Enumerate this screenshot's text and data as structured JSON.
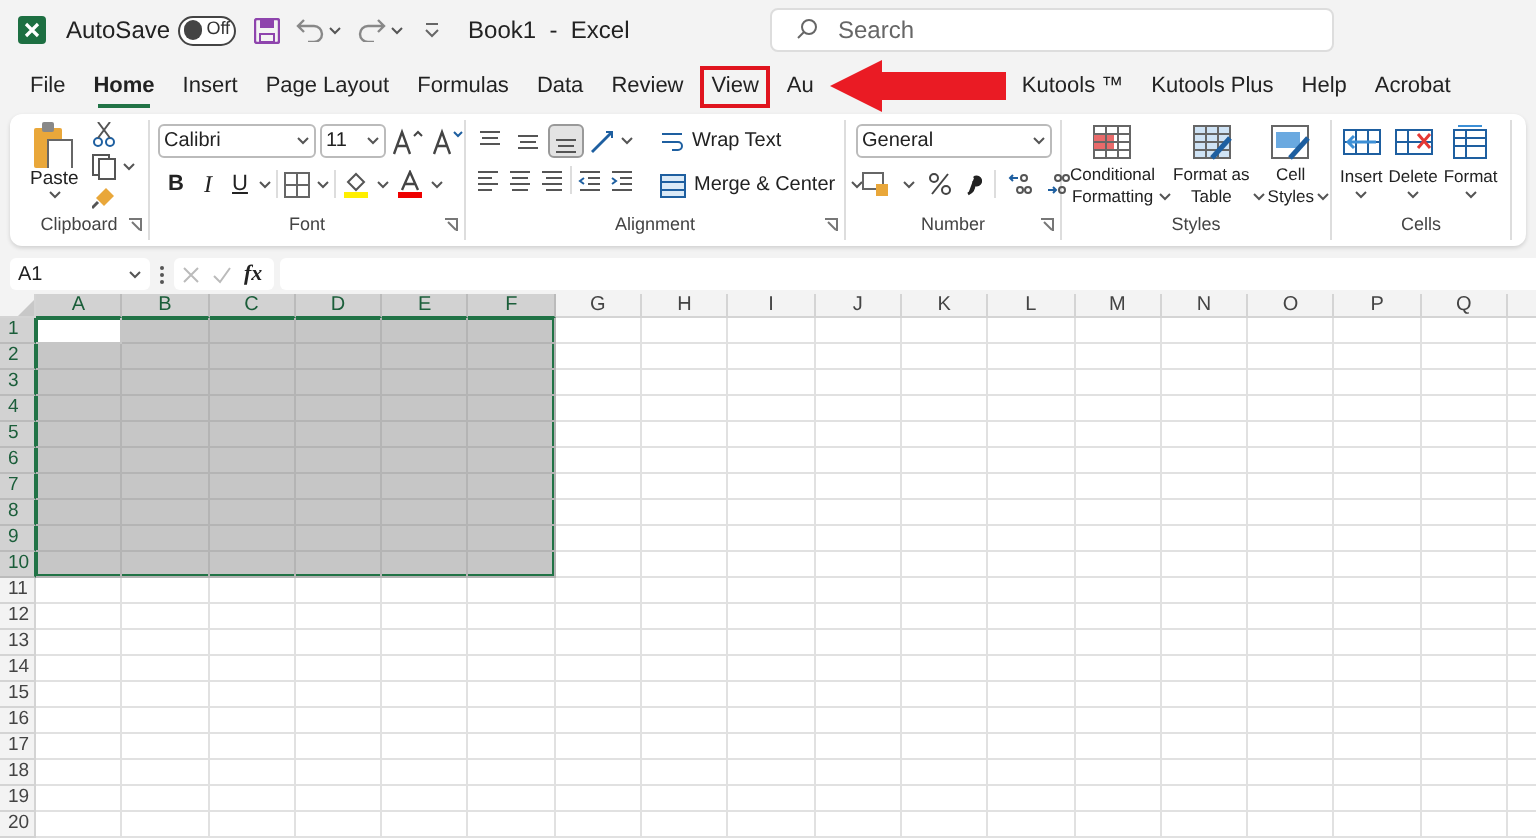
{
  "title_bar": {
    "autosave_label": "AutoSave",
    "autosave": {
      "on": false,
      "label": "Off"
    },
    "document_title": "Book1  -  Excel",
    "search": {
      "placeholder": "Search"
    }
  },
  "tabs": [
    {
      "label": "File",
      "selected": false,
      "highlighted": false
    },
    {
      "label": "Home",
      "selected": true,
      "highlighted": false
    },
    {
      "label": "Insert",
      "selected": false,
      "highlighted": false
    },
    {
      "label": "Page Layout",
      "selected": false,
      "highlighted": false
    },
    {
      "label": "Formulas",
      "selected": false,
      "highlighted": false
    },
    {
      "label": "Data",
      "selected": false,
      "highlighted": false
    },
    {
      "label": "Review",
      "selected": false,
      "highlighted": false
    },
    {
      "label": "View",
      "selected": false,
      "highlighted": true
    },
    {
      "label": "Au",
      "selected": false,
      "highlighted": false
    },
    {
      "label": "Kutools ™",
      "selected": false,
      "highlighted": false
    },
    {
      "label": "Kutools Plus",
      "selected": false,
      "highlighted": false
    },
    {
      "label": "Help",
      "selected": false,
      "highlighted": false
    },
    {
      "label": "Acrobat",
      "selected": false,
      "highlighted": false
    }
  ],
  "ribbon": {
    "groups": [
      {
        "kind": "clipboard",
        "label": "Clipboard",
        "paste": "Paste"
      },
      {
        "kind": "font",
        "label": "Font",
        "font_name": "Calibri",
        "font_size": "11",
        "bold": "B",
        "italic": "I",
        "underline": "U"
      },
      {
        "kind": "alignment",
        "label": "Alignment",
        "vertical_alignment": [
          {
            "kind": "top",
            "selected": false
          },
          {
            "kind": "middle",
            "selected": false
          },
          {
            "kind": "bottom",
            "selected": true
          }
        ],
        "wrap_text": "Wrap Text",
        "merge": "Merge & Center"
      },
      {
        "kind": "number",
        "label": "Number",
        "format": "General"
      },
      {
        "kind": "styles",
        "label": "Styles",
        "buttons": [
          "Conditional\nFormatting",
          "Format as\nTable",
          "Cell\nStyles"
        ]
      },
      {
        "kind": "cells",
        "label": "Cells",
        "buttons": [
          "Insert",
          "Delete",
          "Format"
        ]
      }
    ]
  },
  "formula_bar": {
    "name_box": "A1",
    "function_label": "fx"
  },
  "sheet": {
    "columns": [
      {
        "label": "A",
        "selected": true
      },
      {
        "label": "B",
        "selected": true
      },
      {
        "label": "C",
        "selected": true
      },
      {
        "label": "D",
        "selected": true
      },
      {
        "label": "E",
        "selected": true
      },
      {
        "label": "F",
        "selected": true
      },
      {
        "label": "G",
        "selected": false
      },
      {
        "label": "H",
        "selected": false
      },
      {
        "label": "I",
        "selected": false
      },
      {
        "label": "J",
        "selected": false
      },
      {
        "label": "K",
        "selected": false
      },
      {
        "label": "L",
        "selected": false
      },
      {
        "label": "M",
        "selected": false
      },
      {
        "label": "N",
        "selected": false
      },
      {
        "label": "O",
        "selected": false
      },
      {
        "label": "P",
        "selected": false
      },
      {
        "label": "Q",
        "selected": false
      }
    ],
    "rows": [
      {
        "label": "1",
        "selected": true
      },
      {
        "label": "2",
        "selected": true
      },
      {
        "label": "3",
        "selected": true
      },
      {
        "label": "4",
        "selected": true
      },
      {
        "label": "5",
        "selected": true
      },
      {
        "label": "6",
        "selected": true
      },
      {
        "label": "7",
        "selected": true
      },
      {
        "label": "8",
        "selected": true
      },
      {
        "label": "9",
        "selected": true
      },
      {
        "label": "10",
        "selected": true
      },
      {
        "label": "11",
        "selected": false
      },
      {
        "label": "12",
        "selected": false
      },
      {
        "label": "13",
        "selected": false
      },
      {
        "label": "14",
        "selected": false
      },
      {
        "label": "15",
        "selected": false
      },
      {
        "label": "16",
        "selected": false
      },
      {
        "label": "17",
        "selected": false
      },
      {
        "label": "18",
        "selected": false
      },
      {
        "label": "19",
        "selected": false
      },
      {
        "label": "20",
        "selected": false
      }
    ]
  }
}
